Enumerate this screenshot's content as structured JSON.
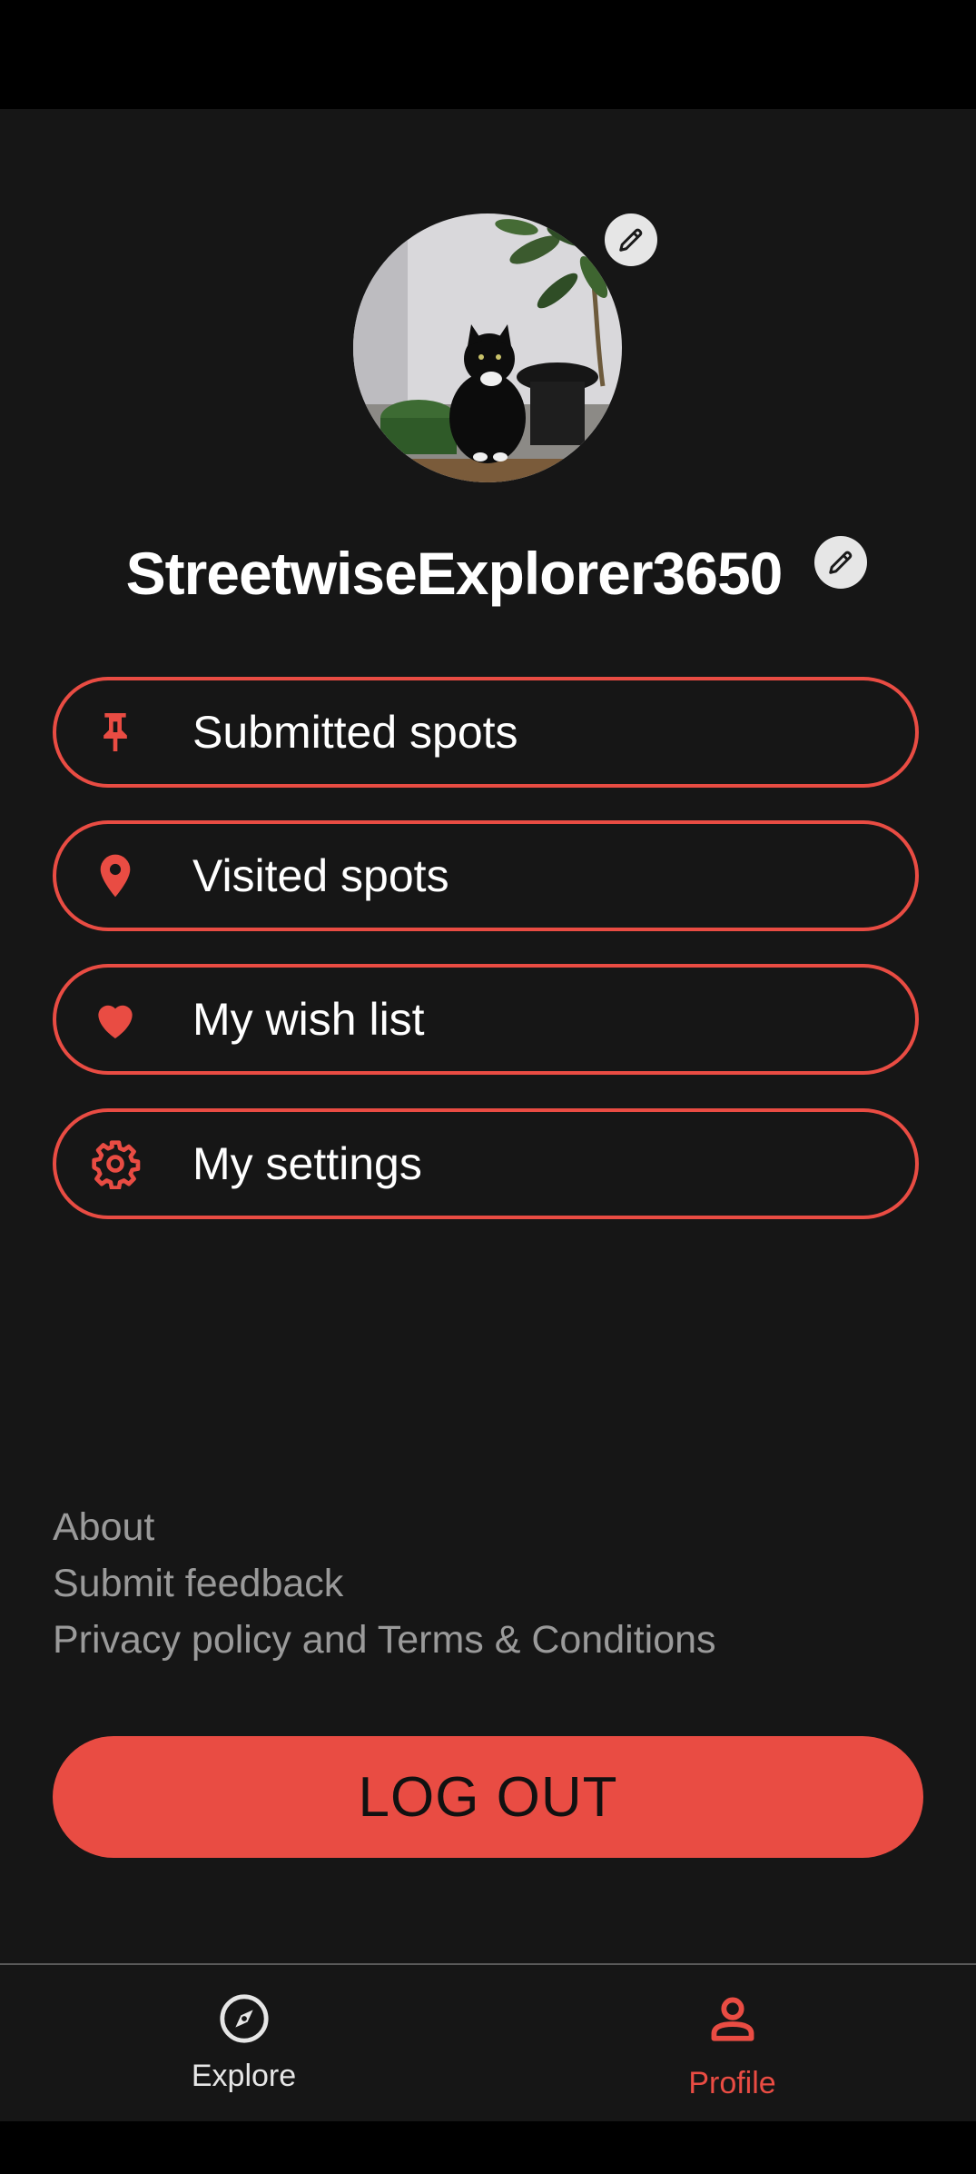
{
  "colors": {
    "accent": "#e94c43",
    "background": "#161616",
    "muted_text": "#9a9a9a"
  },
  "profile": {
    "username": "StreetwiseExplorer3650",
    "avatar_icon": "profile-photo-cat",
    "edit_icon": "pencil-icon"
  },
  "menu": {
    "items": [
      {
        "label": "Submitted spots",
        "icon": "pushpin-icon"
      },
      {
        "label": "Visited spots",
        "icon": "map-marker-icon"
      },
      {
        "label": "My wish list",
        "icon": "heart-icon"
      },
      {
        "label": "My settings",
        "icon": "gear-icon"
      }
    ]
  },
  "footer": {
    "about": "About",
    "feedback": "Submit feedback",
    "privacy": "Privacy policy and Terms & Conditions"
  },
  "logout_label": "LOG OUT",
  "nav": {
    "explore": {
      "label": "Explore",
      "icon": "compass-icon"
    },
    "profile": {
      "label": "Profile",
      "icon": "person-icon",
      "active": true
    }
  }
}
